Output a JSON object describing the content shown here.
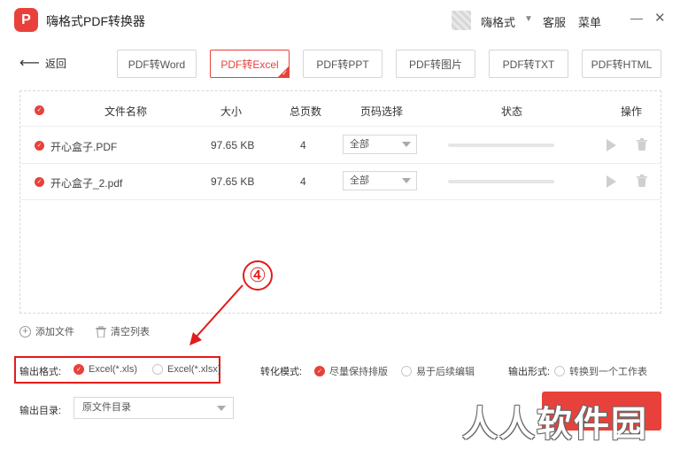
{
  "app": {
    "title": "嗨格式PDF转换器",
    "logo_text": "P",
    "accent": "#e8413b"
  },
  "titlebar": {
    "user_name": "嗨格式",
    "service": "客服",
    "menu": "菜单",
    "minimize": "—",
    "close": "✕"
  },
  "nav": {
    "back_label": "返回"
  },
  "tabs": [
    {
      "label": "PDF转Word",
      "active": false
    },
    {
      "label": "PDF转Excel",
      "active": true
    },
    {
      "label": "PDF转PPT",
      "active": false
    },
    {
      "label": "PDF转图片",
      "active": false
    },
    {
      "label": "PDF转TXT",
      "active": false
    },
    {
      "label": "PDF转HTML",
      "active": false
    }
  ],
  "table": {
    "headers": {
      "name": "文件名称",
      "size": "大小",
      "pages": "总页数",
      "range": "页码选择",
      "status": "状态",
      "action": "操作"
    },
    "rows": [
      {
        "name": "开心盒子.PDF",
        "size": "97.65 KB",
        "pages": "4",
        "range": "全部",
        "progress": 0
      },
      {
        "name": "开心盒子_2.pdf",
        "size": "97.65 KB",
        "pages": "4",
        "range": "全部",
        "progress": 0
      }
    ]
  },
  "actions": {
    "add_file": "添加文件",
    "clear_list": "清空列表"
  },
  "options": {
    "output_format_label": "输出格式:",
    "format_xls": "Excel(*.xls)",
    "format_xlsx": "Excel(*.xlsx)",
    "selected_format": "Excel(*.xls)",
    "mode_label": "转化模式:",
    "mode_keep_layout": "尽量保持排版",
    "mode_easy_edit": "易于后续编辑",
    "selected_mode": "尽量保持排版",
    "form_label": "输出形式:",
    "form_single_sheet": "转换到一个工作表",
    "form_single_sheet_checked": false,
    "dir_label": "输出目录:",
    "dir_value": "原文件目录"
  },
  "annotation": {
    "step_number": "④"
  },
  "watermark": {
    "text": "人人软件园"
  }
}
